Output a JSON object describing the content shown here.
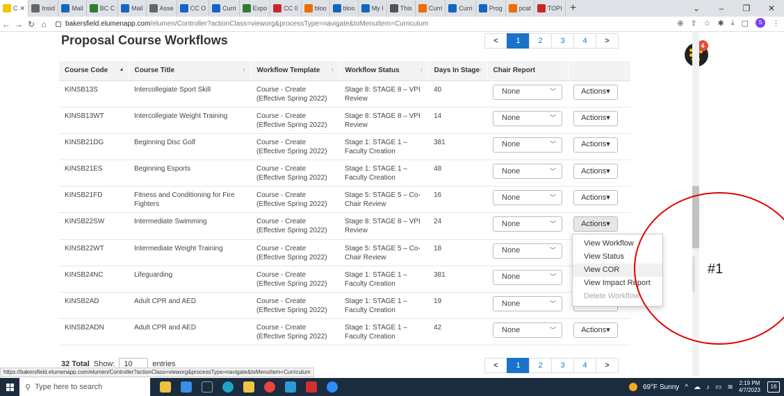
{
  "browser": {
    "tabs": [
      {
        "label": "C",
        "color": "#f5c400",
        "active": true
      },
      {
        "label": "Insid",
        "color": "#666666"
      },
      {
        "label": "Mail",
        "color": "#1565c0"
      },
      {
        "label": "BC C",
        "color": "#2e7d32"
      },
      {
        "label": "Mail",
        "color": "#1565c0"
      },
      {
        "label": "Asse",
        "color": "#666666"
      },
      {
        "label": "CC O",
        "color": "#1565c0"
      },
      {
        "label": "Curri",
        "color": "#1565c0"
      },
      {
        "label": "Expo",
        "color": "#2e7d32"
      },
      {
        "label": "CC 0",
        "color": "#c62828"
      },
      {
        "label": "bloo",
        "color": "#ef6c00"
      },
      {
        "label": "bloo",
        "color": "#1565c0"
      },
      {
        "label": "My I",
        "color": "#1565c0"
      },
      {
        "label": "This",
        "color": "#555555"
      },
      {
        "label": "Curri",
        "color": "#ef6c00"
      },
      {
        "label": "Curri",
        "color": "#1565c0"
      },
      {
        "label": "Prog",
        "color": "#1565c0"
      },
      {
        "label": "pcat",
        "color": "#ef6c00"
      },
      {
        "label": "TOPI",
        "color": "#c62828"
      }
    ],
    "new_tab": "+",
    "url_host": "bakersfield.elumenapp.com",
    "url_path": "/elumen/Controller?actionClass=vieworg&processType=navigate&toMenuItem=Curriculum",
    "status_url": "https://bakersfield.elumenapp.com/elumen/Controller?actionClass=vieworg&processType=navigate&toMenuItem=Curriculum",
    "profile_initial": "S"
  },
  "page": {
    "title": "Proposal Course Workflows",
    "badge_count": "4",
    "pagination": {
      "prev": "<",
      "pages": [
        "1",
        "2",
        "3",
        "4"
      ],
      "active": "1",
      "next": ">"
    },
    "columns": [
      "Course Code",
      "Course Title",
      "Workflow Template",
      "Workflow Status",
      "Days In Stage",
      "Chair Report",
      ""
    ],
    "rows": [
      {
        "code": "KINSB13S",
        "title": "Intercollegiate Sport Skill",
        "template": "Course - Create (Effective Spring 2022)",
        "status": "Stage 8: STAGE 8 – VPI Review",
        "days": "40",
        "chair": "None",
        "actions": "Actions"
      },
      {
        "code": "KINSB13WT",
        "title": "Intercollegiate Weight Training",
        "template": "Course - Create (Effective Spring 2022)",
        "status": "Stage 8: STAGE 8 – VPI Review",
        "days": "14",
        "chair": "None",
        "actions": "Actions"
      },
      {
        "code": "KINSB21DG",
        "title": "Beginning Disc Golf",
        "template": "Course - Create (Effective Spring 2022)",
        "status": "Stage 1: STAGE 1 – Faculty Creation",
        "days": "381",
        "chair": "None",
        "actions": "Actions"
      },
      {
        "code": "KINSB21ES",
        "title": "Beginning Esports",
        "template": "Course - Create (Effective Spring 2022)",
        "status": "Stage 1: STAGE 1 – Faculty Creation",
        "days": "48",
        "chair": "None",
        "actions": "Actions"
      },
      {
        "code": "KINSB21FD",
        "title": "Fitness and Conditioning for Fire Fighters",
        "template": "Course - Create (Effective Spring 2022)",
        "status": "Stage 5: STAGE 5 – Co-Chair Review",
        "days": "16",
        "chair": "None",
        "actions": "Actions"
      },
      {
        "code": "KINSB22SW",
        "title": "Intermediate Swimming",
        "template": "Course - Create (Effective Spring 2022)",
        "status": "Stage 8: STAGE 8 – VPI Review",
        "days": "24",
        "chair": "None",
        "actions": "Actions"
      },
      {
        "code": "KINSB22WT",
        "title": "Intermediate Weight Training",
        "template": "Course - Create (Effective Spring 2022)",
        "status": "Stage 5: STAGE 5 – Co-Chair Review",
        "days": "18",
        "chair": "None",
        "actions": "Actions"
      },
      {
        "code": "KINSB24NC",
        "title": "Lifeguarding",
        "template": "Course - Create (Effective Spring 2022)",
        "status": "Stage 1: STAGE 1 – Faculty Creation",
        "days": "381",
        "chair": "None",
        "actions": "Actions"
      },
      {
        "code": "KINSB2AD",
        "title": "Adult CPR and AED",
        "template": "Course - Create (Effective Spring 2022)",
        "status": "Stage 1: STAGE 1 – Faculty Creation",
        "days": "19",
        "chair": "None",
        "actions": "Actions"
      },
      {
        "code": "KINSB2ADN",
        "title": "Adult CPR and AED",
        "template": "Course - Create (Effective Spring 2022)",
        "status": "Stage 1: STAGE 1 – Faculty Creation",
        "days": "42",
        "chair": "None",
        "actions": "Actions"
      }
    ],
    "open_actions_row": 5,
    "actions_menu": [
      "View Workflow",
      "View Status",
      "View COR",
      "View Impact Report",
      "Delete Workflow"
    ],
    "hovered_menu_item": "View COR",
    "disabled_menu_item": "Delete Workflow",
    "total_label": "32 Total",
    "show_label": "Show:",
    "entries_value": "10",
    "entries_label": "entries",
    "annotation": "#1"
  },
  "taskbar": {
    "search_placeholder": "Type here to search",
    "weather": "69°F  Sunny",
    "time": "2:19 PM",
    "date": "4/7/2023",
    "notifications": "16"
  }
}
